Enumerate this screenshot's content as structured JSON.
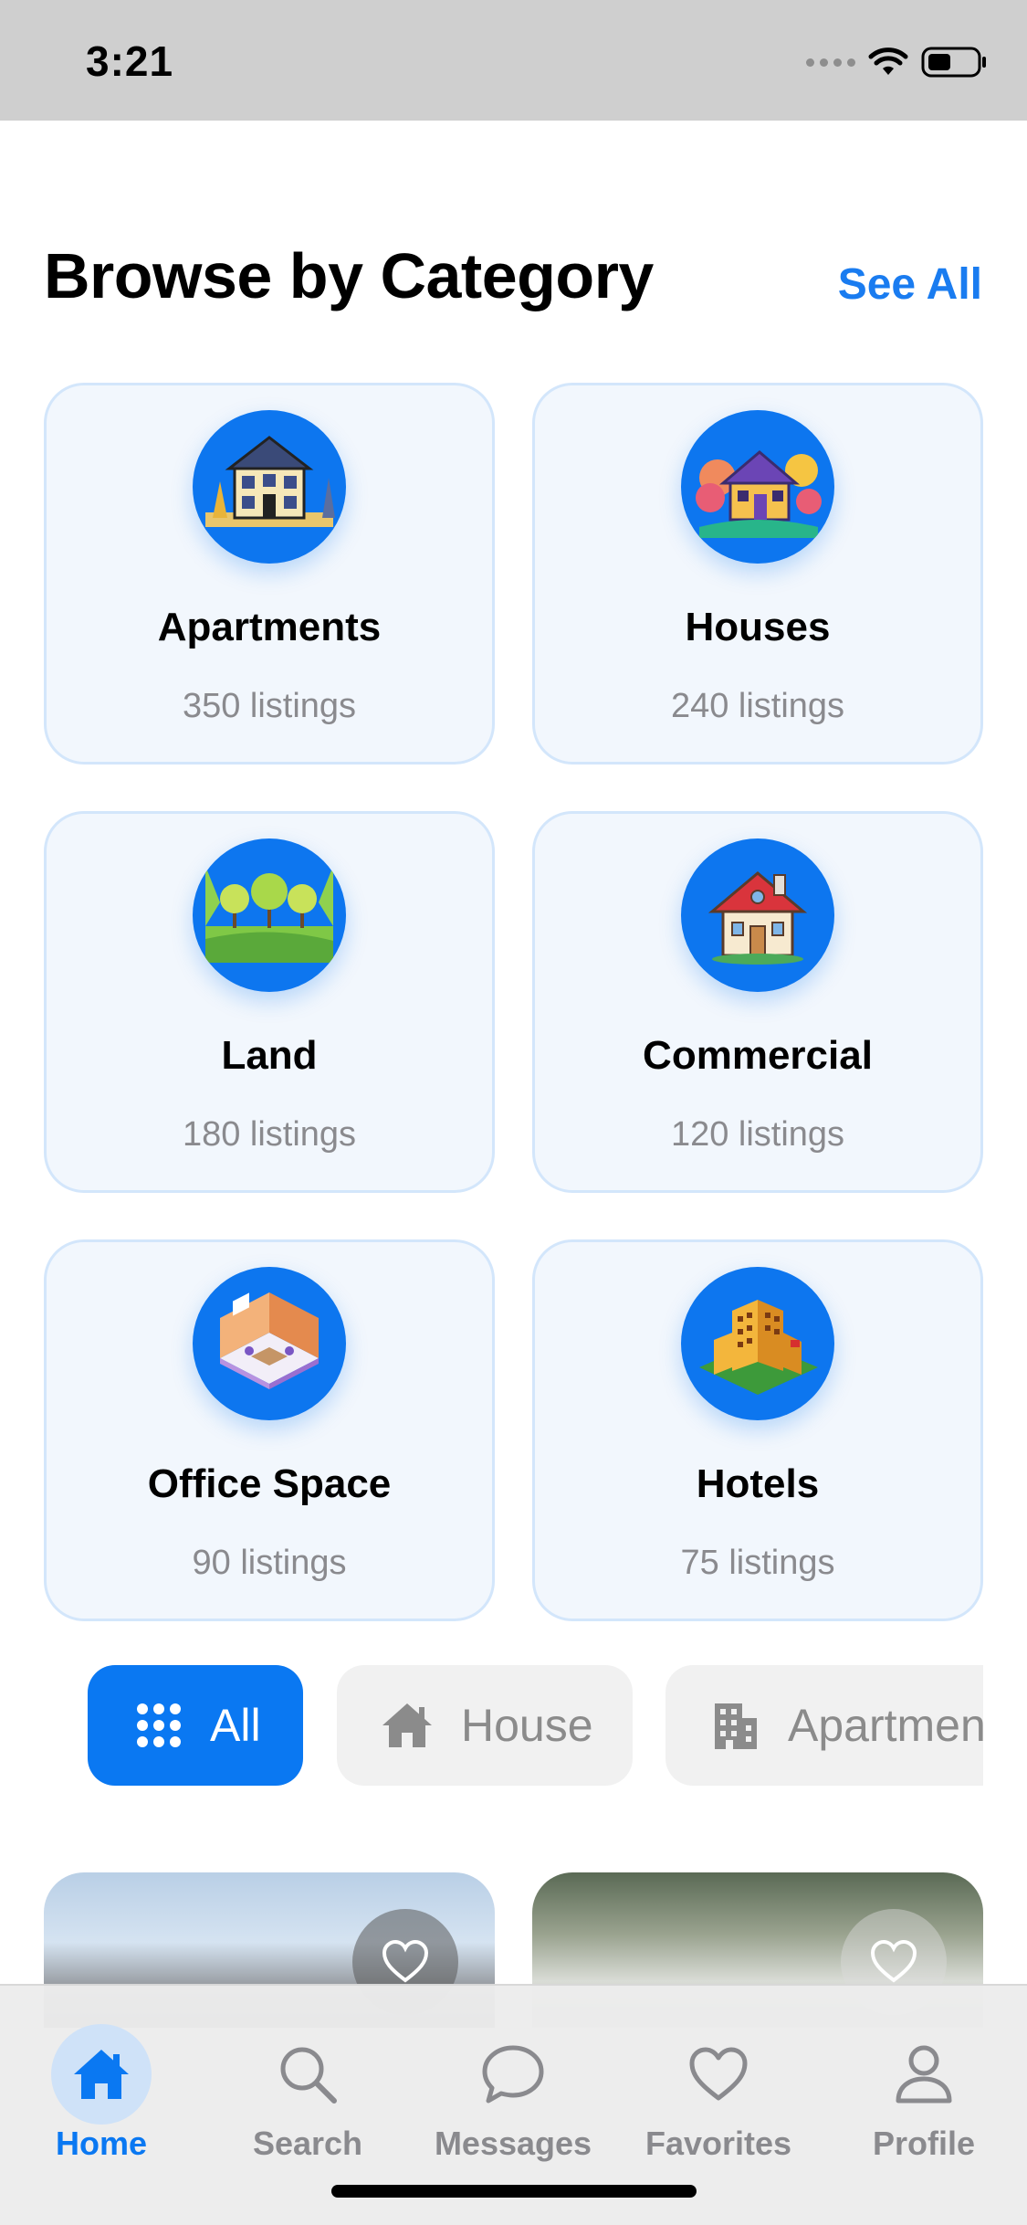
{
  "status_bar": {
    "time": "3:21"
  },
  "header": {
    "title": "Browse by Category",
    "see_all": "See All"
  },
  "categories": [
    {
      "name": "Apartments",
      "count": "350 listings",
      "icon": "apartment-building-icon"
    },
    {
      "name": "Houses",
      "count": "240 listings",
      "icon": "house-icon"
    },
    {
      "name": "Land",
      "count": "180 listings",
      "icon": "land-icon"
    },
    {
      "name": "Commercial",
      "count": "120 listings",
      "icon": "commercial-building-icon"
    },
    {
      "name": "Office Space",
      "count": "90 listings",
      "icon": "office-space-icon"
    },
    {
      "name": "Hotels",
      "count": "75 listings",
      "icon": "hotel-icon"
    }
  ],
  "filters": [
    {
      "label": "All",
      "icon": "grid-dots-icon",
      "selected": true
    },
    {
      "label": "House",
      "icon": "house-icon",
      "selected": false
    },
    {
      "label": "Apartment",
      "icon": "building-icon",
      "selected": false
    }
  ],
  "tab_bar": {
    "items": [
      {
        "label": "Home",
        "icon": "home-icon",
        "active": true
      },
      {
        "label": "Search",
        "icon": "search-icon",
        "active": false
      },
      {
        "label": "Messages",
        "icon": "chat-bubble-icon",
        "active": false
      },
      {
        "label": "Favorites",
        "icon": "heart-icon",
        "active": false
      },
      {
        "label": "Profile",
        "icon": "person-icon",
        "active": false
      }
    ]
  },
  "colors": {
    "accent": "#0a78f2",
    "card_bg": "#f2f7fd",
    "card_border": "#d3e6fb",
    "muted_text": "#8a8a8e"
  }
}
